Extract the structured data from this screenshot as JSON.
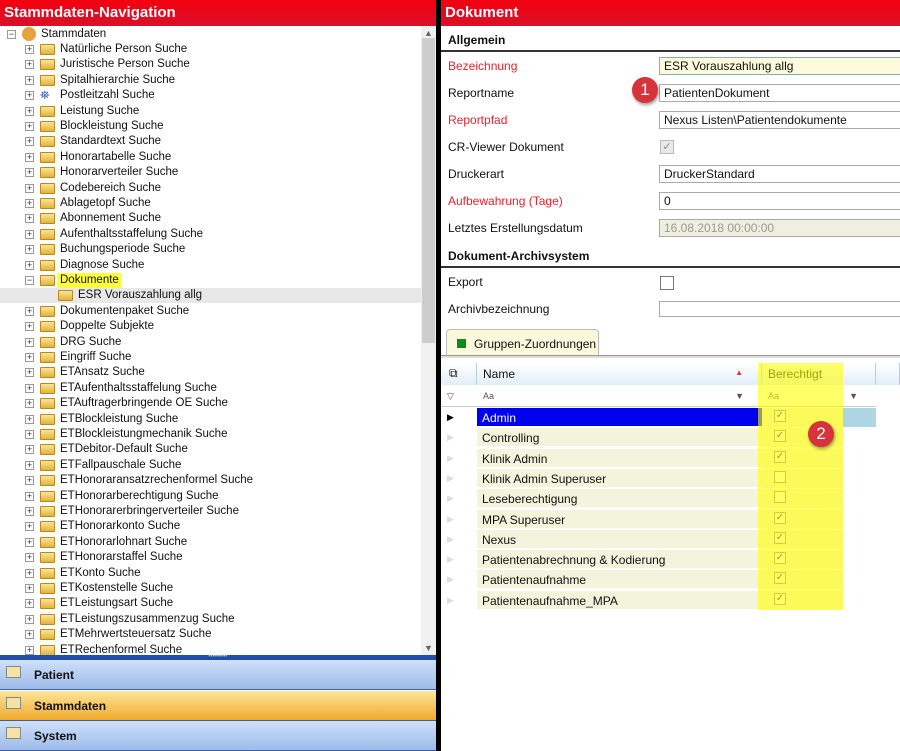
{
  "left": {
    "title": "Stammdaten-Navigation",
    "root": "Stammdaten",
    "items": [
      {
        "label": "Natürliche Person Suche"
      },
      {
        "label": "Juristische Person Suche"
      },
      {
        "label": "Spitalhierarchie Suche"
      },
      {
        "label": "Postleitzahl Suche",
        "icon": "binoculars"
      },
      {
        "label": "Leistung Suche"
      },
      {
        "label": "Blockleistung Suche"
      },
      {
        "label": "Standardtext Suche"
      },
      {
        "label": "Honorartabelle Suche"
      },
      {
        "label": "Honorarverteiler Suche"
      },
      {
        "label": "Codebereich Suche"
      },
      {
        "label": "Ablagetopf Suche"
      },
      {
        "label": "Abonnement Suche"
      },
      {
        "label": "Aufenthaltsstaffelung Suche"
      },
      {
        "label": "Buchungsperiode Suche"
      },
      {
        "label": "Diagnose Suche"
      },
      {
        "label": "Dokumente",
        "expanded": true,
        "highlight": true
      },
      {
        "label": "ESR Vorauszahlung allg",
        "child": true,
        "selected": true
      },
      {
        "label": "Dokumentenpaket Suche"
      },
      {
        "label": "Doppelte Subjekte"
      },
      {
        "label": "DRG Suche"
      },
      {
        "label": "Eingriff Suche"
      },
      {
        "label": "ETAnsatz Suche"
      },
      {
        "label": "ETAufenthaltsstaffelung Suche"
      },
      {
        "label": "ETAuftragerbringende OE Suche"
      },
      {
        "label": "ETBlockleistung Suche"
      },
      {
        "label": "ETBlockleistungmechanik Suche"
      },
      {
        "label": "ETDebitor-Default Suche"
      },
      {
        "label": "ETFallpauschale Suche"
      },
      {
        "label": "ETHonoraransatzrechenformel Suche"
      },
      {
        "label": "ETHonorarberechtigung Suche"
      },
      {
        "label": "ETHonorarerbringerverteiler Suche"
      },
      {
        "label": "ETHonorarkonto Suche"
      },
      {
        "label": "ETHonorarlohnart Suche"
      },
      {
        "label": "ETHonorarstaffel Suche"
      },
      {
        "label": "ETKonto Suche"
      },
      {
        "label": "ETKostenstelle Suche"
      },
      {
        "label": "ETLeistungsart Suche"
      },
      {
        "label": "ETLeistungszusammenzug Suche"
      },
      {
        "label": "ETMehrwertsteuersatz Suche"
      },
      {
        "label": "ETRechenformel Suche"
      }
    ],
    "nav": [
      {
        "label": "Patient"
      },
      {
        "label": "Stammdaten",
        "active": true
      },
      {
        "label": "System"
      }
    ]
  },
  "right": {
    "title": "Dokument",
    "section1": "Allgemein",
    "fields": {
      "bezeichnung": {
        "label": "Bezeichnung",
        "value": "ESR Vorauszahlung allg"
      },
      "reportname": {
        "label": "Reportname",
        "value": "PatientenDokument"
      },
      "reportpfad": {
        "label": "Reportpfad",
        "value": "Nexus Listen\\Patientendokumente"
      },
      "crviewer": {
        "label": "CR-Viewer Dokument",
        "checked": true
      },
      "druckerart": {
        "label": "Druckerart",
        "value": "DruckerStandard"
      },
      "aufbewahrung": {
        "label": "Aufbewahrung (Tage)",
        "value": "0"
      },
      "letztes": {
        "label": "Letztes Erstellungsdatum",
        "value": "16.08.2018 00:00:00"
      }
    },
    "section2": "Dokument-Archivsystem",
    "export": {
      "label": "Export",
      "checked": false
    },
    "archiv": {
      "label": "Archivbezeichnung",
      "value": ""
    },
    "tab": "Gruppen-Zuordnungen",
    "badge1": "1",
    "badge2": "2",
    "grid": {
      "col_name": "Name",
      "col_ber": "Berechtigt",
      "filter": "Aa",
      "rows": [
        {
          "name": "Admin",
          "ok": true
        },
        {
          "name": "Controlling",
          "ok": true
        },
        {
          "name": "Klinik Admin",
          "ok": true
        },
        {
          "name": "Klinik Admin Superuser",
          "ok": false
        },
        {
          "name": "Leseberechtigung",
          "ok": false
        },
        {
          "name": "MPA Superuser",
          "ok": true
        },
        {
          "name": "Nexus",
          "ok": true
        },
        {
          "name": "Patientenabrechnung & Kodierung",
          "ok": true
        },
        {
          "name": "Patientenaufnahme",
          "ok": true
        },
        {
          "name": "Patientenaufnahme_MPA",
          "ok": true
        }
      ]
    }
  }
}
